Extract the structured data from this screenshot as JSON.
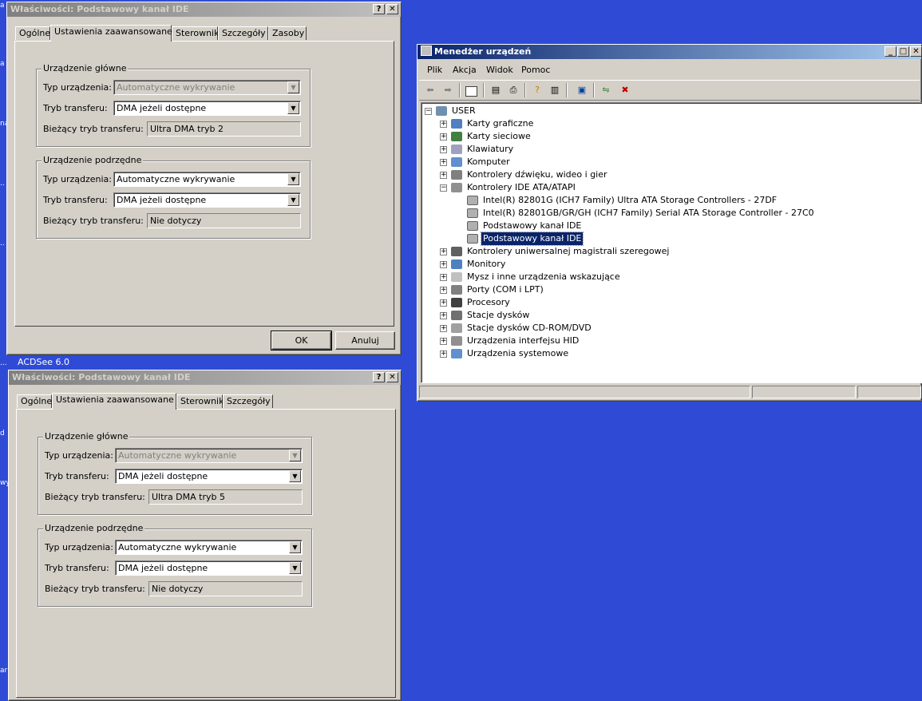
{
  "desktop": {
    "taskbar_label": "ACDSee 6.0"
  },
  "dialog1": {
    "title": "Właściwości: Podstawowy kanał IDE",
    "help_btn": "?",
    "close_btn": "✕",
    "tabs": [
      "Ogólne",
      "Ustawienia zaawansowane",
      "Sterownik",
      "Szczegóły",
      "Zasoby"
    ],
    "primary": {
      "group_label": "Urządzenie główne",
      "type_label": "Typ urządzenia:",
      "type_value": "Automatyczne wykrywanie",
      "transfer_label": "Tryb transferu:",
      "transfer_value": "DMA jeżeli dostępne",
      "current_label": "Bieżący tryb transferu:",
      "current_value": "Ultra DMA tryb 2"
    },
    "secondary": {
      "group_label": "Urządzenie podrzędne",
      "type_label": "Typ urządzenia:",
      "type_value": "Automatyczne wykrywanie",
      "transfer_label": "Tryb transferu:",
      "transfer_value": "DMA jeżeli dostępne",
      "current_label": "Bieżący tryb transferu:",
      "current_value": "Nie dotyczy"
    },
    "ok": "OK",
    "cancel": "Anuluj"
  },
  "dialog2": {
    "title": "Właściwości: Podstawowy kanał IDE",
    "help_btn": "?",
    "close_btn": "✕",
    "tabs": [
      "Ogólne",
      "Ustawienia zaawansowane",
      "Sterownik",
      "Szczegóły"
    ],
    "primary": {
      "group_label": "Urządzenie główne",
      "type_label": "Typ urządzenia:",
      "type_value": "Automatyczne wykrywanie",
      "transfer_label": "Tryb transferu:",
      "transfer_value": "DMA jeżeli dostępne",
      "current_label": "Bieżący tryb transferu:",
      "current_value": "Ultra DMA tryb 5"
    },
    "secondary": {
      "group_label": "Urządzenie podrzędne",
      "type_label": "Typ urządzenia:",
      "type_value": "Automatyczne wykrywanie",
      "transfer_label": "Tryb transferu:",
      "transfer_value": "DMA jeżeli dostępne",
      "current_label": "Bieżący tryb transferu:",
      "current_value": "Nie dotyczy"
    }
  },
  "devmgr": {
    "title": "Menedżer urządzeń",
    "min_btn": "_",
    "max_btn": "□",
    "close_btn": "✕",
    "menus": [
      "Plik",
      "Akcja",
      "Widok",
      "Pomoc"
    ],
    "root": "USER",
    "categories": [
      "Karty graficzne",
      "Karty sieciowe",
      "Klawiatury",
      "Komputer",
      "Kontrolery dźwięku, wideo i gier",
      "Kontrolery IDE ATA/ATAPI",
      "Kontrolery uniwersalnej magistrali szeregowej",
      "Monitory",
      "Mysz i inne urządzenia wskazujące",
      "Porty (COM i LPT)",
      "Procesory",
      "Stacje dysków",
      "Stacje dysków CD-ROM/DVD",
      "Urządzenia interfejsu HID",
      "Urządzenia systemowe"
    ],
    "ide_children": [
      "Intel(R) 82801G (ICH7 Family) Ultra ATA Storage Controllers - 27DF",
      "Intel(R) 82801GB/GR/GH (ICH7 Family) Serial ATA Storage Controller - 27C0",
      "Podstawowy kanał IDE",
      "Podstawowy kanał IDE"
    ],
    "selected_child": "Podstawowy kanał IDE"
  },
  "colors": {
    "desktop": "#2f4bd6",
    "active_title": "#0a246a",
    "inactive_title": "#808080",
    "face": "#d4d0c8"
  }
}
